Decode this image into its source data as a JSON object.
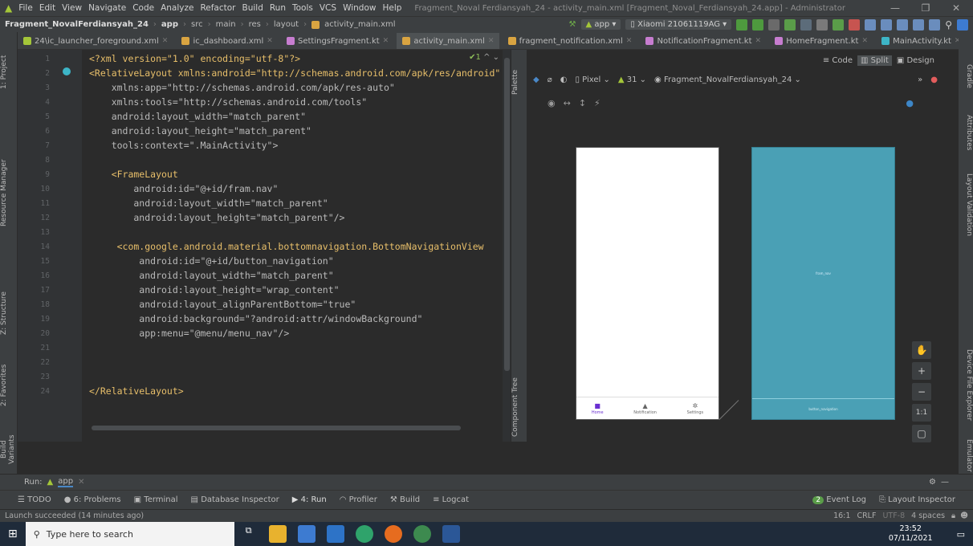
{
  "menu": [
    "File",
    "Edit",
    "View",
    "Navigate",
    "Code",
    "Analyze",
    "Refactor",
    "Build",
    "Run",
    "Tools",
    "VCS",
    "Window",
    "Help"
  ],
  "window_title": "Fragment_Noval Ferdiansyah_24 - activity_main.xml [Fragment_Noval_Ferdiansyah_24.app] - Administrator",
  "breadcrumb": {
    "project": "Fragment_NovalFerdiansyah_24",
    "app": "app",
    "src": "src",
    "main": "main",
    "res": "res",
    "layout": "layout",
    "file": "activity_main.xml"
  },
  "toolbar": {
    "run_config": "app",
    "device": "Xiaomi 21061119AG"
  },
  "tabs": [
    "24\\ic_launcher_foreground.xml",
    "ic_dashboard.xml",
    "SettingsFragment.kt",
    "activity_main.xml",
    "fragment_notification.xml",
    "NotificationFragment.kt",
    "HomeFragment.kt",
    "MainActivity.kt"
  ],
  "view_modes": {
    "code": "Code",
    "split": "Split",
    "design": "Design"
  },
  "design_toolbar": {
    "device": "Pixel",
    "api": "31",
    "theme": "Fragment_NovalFerdiansyah_24"
  },
  "left_tabs": {
    "project": "1: Project",
    "resource": "Resource Manager",
    "structure": "Z: Structure",
    "favorites": "2: Favorites",
    "variants": "Build Variants"
  },
  "right_tabs": {
    "gradle": "Gradle",
    "attributes": "Attributes",
    "layout_validation": "Layout Validation",
    "device_file": "Device File Explorer",
    "emulator": "Emulator"
  },
  "side_panels": {
    "palette": "Palette",
    "component_tree": "Component Tree"
  },
  "code": {
    "l1": "<?xml version=\"1.0\" encoding=\"utf-8\"?>",
    "l2": "<RelativeLayout xmlns:android=\"http://schemas.android.com/apk/res/android\"",
    "l3": "    xmlns:app=\"http://schemas.android.com/apk/res-auto\"",
    "l4": "    xmlns:tools=\"http://schemas.android.com/tools\"",
    "l5": "    android:layout_width=\"match_parent\"",
    "l6": "    android:layout_height=\"match_parent\"",
    "l7": "    tools:context=\".MainActivity\">",
    "l9": "    <FrameLayout",
    "l10": "        android:id=\"@+id/fram.nav\"",
    "l11": "        android:layout_width=\"match_parent\"",
    "l12": "        android:layout_height=\"match_parent\"/>",
    "l14": "     <com.google.android.material.bottomnavigation.BottomNavigationView",
    "l15": "         android:id=\"@+id/button_navigation\"",
    "l16": "         android:layout_width=\"match_parent\"",
    "l17": "         android:layout_height=\"wrap_content\"",
    "l18": "         android:layout_alignParentBottom=\"true\"",
    "l19": "         android:background=\"?android:attr/windowBackground\"",
    "l20": "         app:menu=\"@menu/menu_nav\"/>",
    "l24": "</RelativeLayout>"
  },
  "inspection": "1",
  "preview": {
    "nav_items": [
      "Home",
      "Notification",
      "Settings"
    ],
    "blueprint_frame": "fram_nav",
    "blueprint_nav": "button_navigation"
  },
  "zoom": {
    "fit": "1:1"
  },
  "run": {
    "label": "Run:",
    "config": "app"
  },
  "toolwindows": [
    "TODO",
    "6: Problems",
    "Terminal",
    "Database Inspector",
    "4: Run",
    "Profiler",
    "Build",
    "Logcat"
  ],
  "event_log": {
    "count": "2",
    "label": "Event Log"
  },
  "layout_inspector": "Layout Inspector",
  "status": {
    "message": "Launch succeeded (14 minutes ago)",
    "position": "16:1",
    "line_sep": "CRLF",
    "encoding": "UTF-8",
    "indent": "4 spaces"
  },
  "taskbar": {
    "search_placeholder": "Type here to search",
    "time": "23:52",
    "date": "07/11/2021"
  },
  "colors": {
    "accent": "#4a88c7",
    "blueprint": "#4aa0b5",
    "android_green": "#a4c639"
  }
}
